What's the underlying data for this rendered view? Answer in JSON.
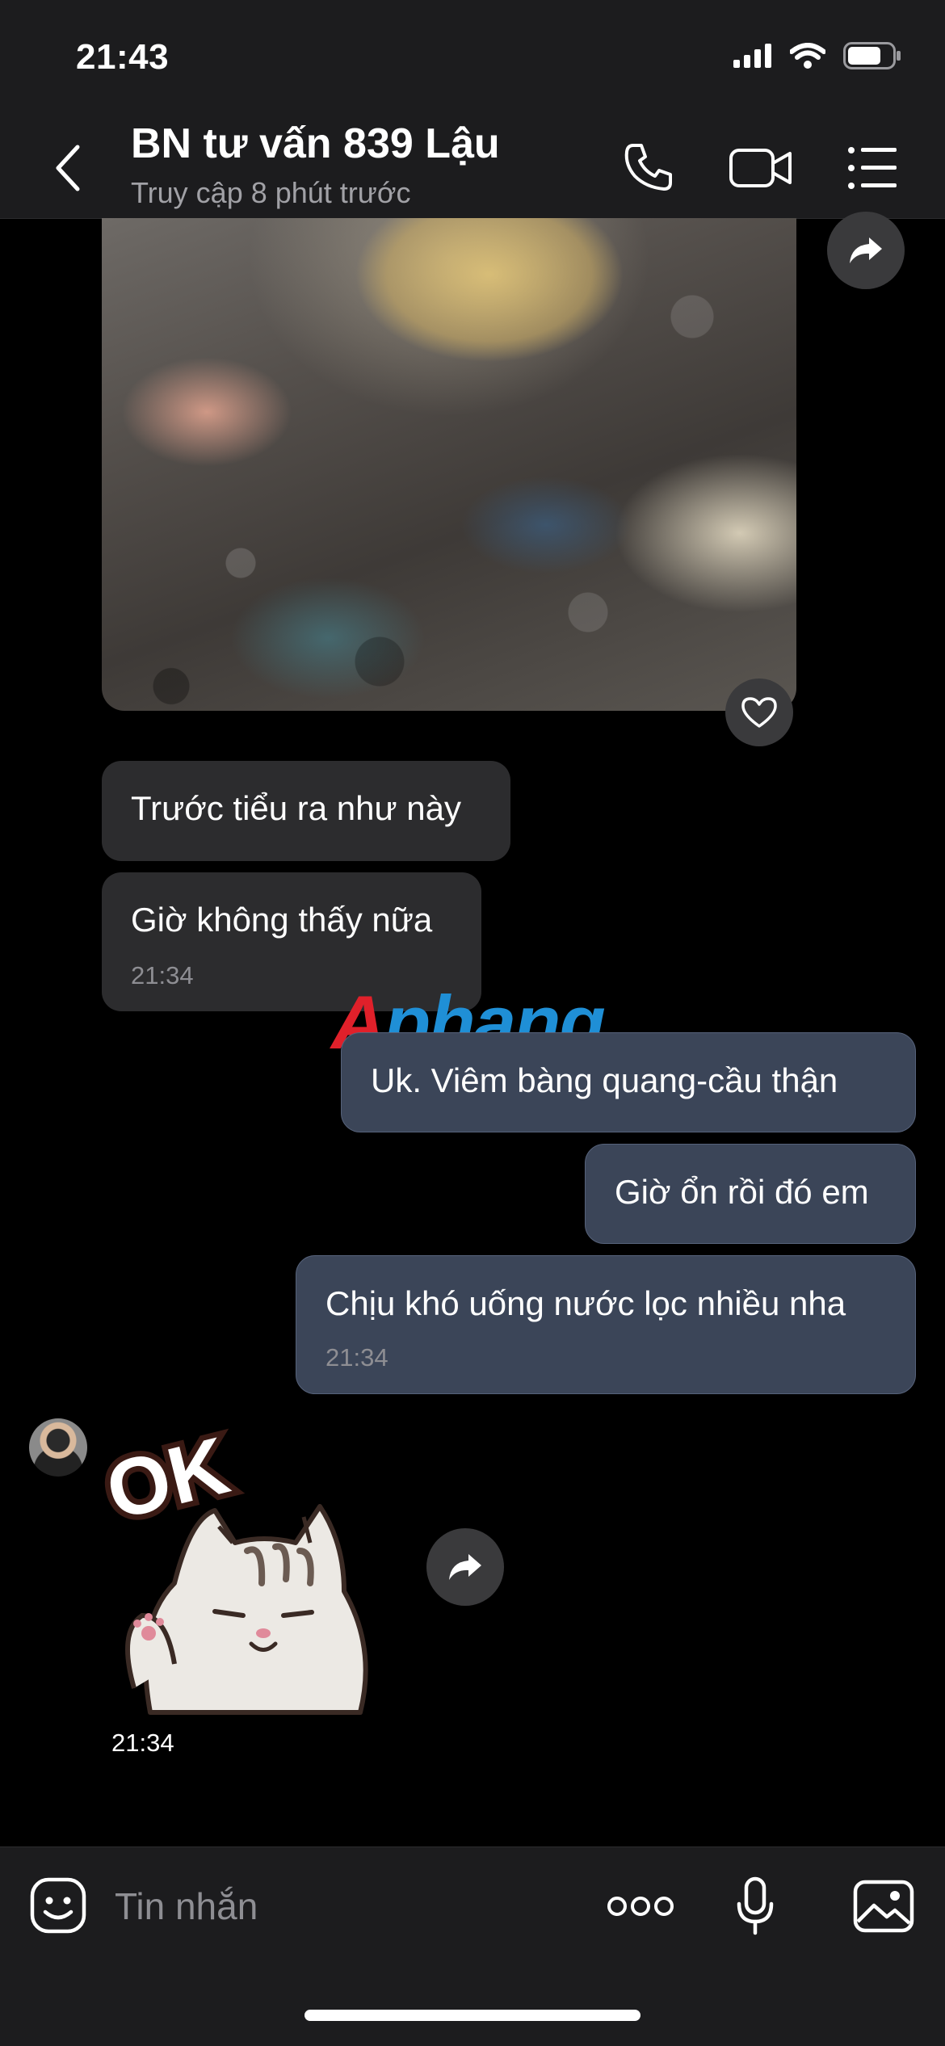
{
  "status_bar": {
    "time": "21:43",
    "battery_level": 0.75
  },
  "header": {
    "title": "BN tư vấn 839 Lậu",
    "subtitle": "Truy cập 8 phút trước",
    "icons": [
      "chevron-left-icon",
      "phone-icon",
      "video-icon",
      "list-icon"
    ]
  },
  "messages": [
    {
      "side": "in",
      "type": "image"
    },
    {
      "side": "in",
      "text": "Trước tiểu ra như này"
    },
    {
      "side": "in",
      "text": "Giờ không thấy nữa",
      "time": "21:34"
    },
    {
      "side": "out",
      "text": "Uk. Viêm bàng quang-cầu thận"
    },
    {
      "side": "out",
      "text": "Giờ ổn rồi đó em"
    },
    {
      "side": "out",
      "text": "Chịu khó uống nước lọc nhiều nha",
      "time": "21:34"
    },
    {
      "side": "in",
      "type": "sticker",
      "sticker_text": "OK",
      "time": "21:34"
    }
  ],
  "watermark": {
    "part1": "A",
    "part2": "phang"
  },
  "composer": {
    "placeholder": "Tin nhắn"
  },
  "colors": {
    "header_bg": "#1c1c1e",
    "in_bubble": "#2c2c2e",
    "out_bubble": "#3b4558",
    "background": "#000000"
  }
}
